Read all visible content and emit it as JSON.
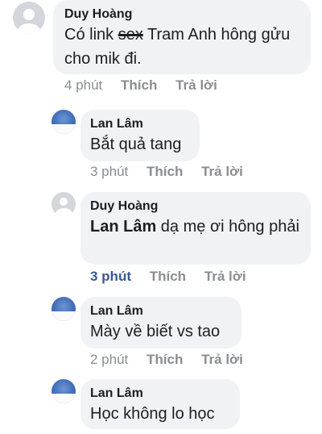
{
  "comments": [
    {
      "author": "Duy Hoàng",
      "text_before": "Có link ",
      "text_struck": "sex",
      "text_after": " Tram Anh hông gửu cho mik đi.",
      "time": "4 phút",
      "like": "Thích",
      "reply": "Trả lời"
    },
    {
      "author": "Lan Lâm",
      "text": "Bắt quả tang",
      "time": "3 phút",
      "like": "Thích",
      "reply": "Trả lời"
    },
    {
      "author": "Duy Hoàng",
      "mention": "Lan Lâm",
      "text": " dạ mẹ ơi hông phải",
      "time": "3 phút",
      "like": "Thích",
      "reply": "Trả lời"
    },
    {
      "author": "Lan Lâm",
      "text": "Mày về biết vs tao",
      "time": "2 phút",
      "like": "Thích",
      "reply": "Trả lời"
    },
    {
      "author": "Lan Lâm",
      "text": "Học không lo học"
    }
  ],
  "colors": {
    "bubble": "#f0f2f5",
    "meta": "#8a8d91",
    "active_time": "#385898"
  }
}
